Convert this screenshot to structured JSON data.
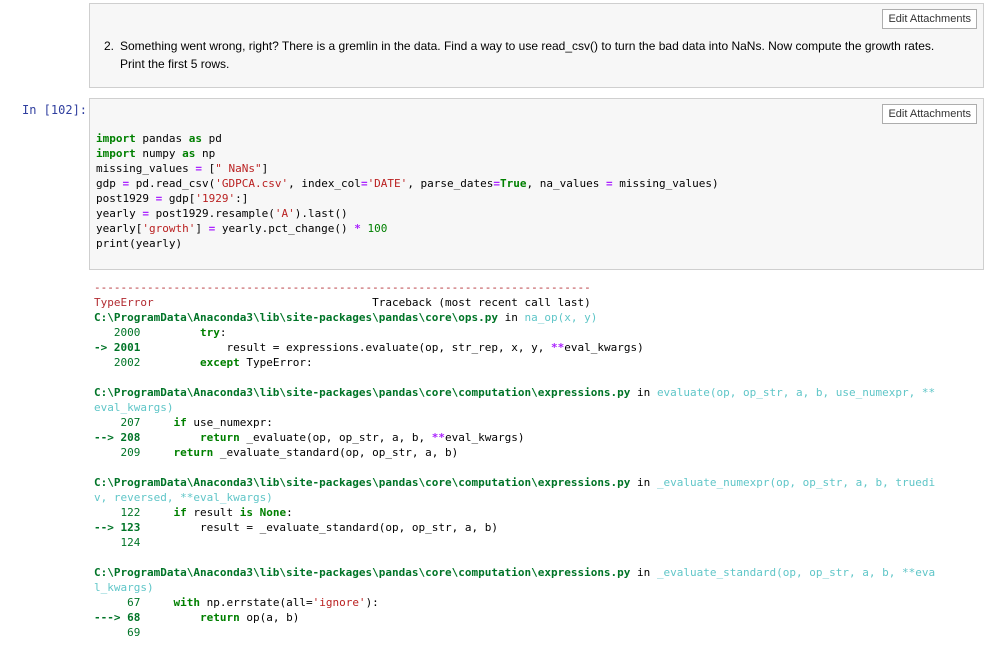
{
  "markdown_cell": {
    "edit_button": "Edit Attachments",
    "item_number": "2.",
    "text_line1": "Something went wrong, right? There is a gremlin in the data. Find a way to use read_csv() to turn the bad data into NaNs. Now compute the growth rates.",
    "text_line2": "Print the first 5 rows."
  },
  "code_cell": {
    "prompt": "In [102]:",
    "edit_button": "Edit Attachments"
  },
  "output": {
    "dashes": "---------------------------------------------------------------------------",
    "error_type": "TypeError",
    "traceback_header": "Traceback (most recent call last)",
    "frames": [
      {
        "path": "C:\\ProgramData\\Anaconda3\\lib\\site-packages\\pandas\\core\\ops.py",
        "func": "na_op(x, y)"
      },
      {
        "path": "C:\\ProgramData\\Anaconda3\\lib\\site-packages\\pandas\\core\\computation\\expressions.py",
        "func": "evaluate(op, op_str, a, b, use_numexpr, **",
        "func_cont": "eval_kwargs)"
      },
      {
        "path": "C:\\ProgramData\\Anaconda3\\lib\\site-packages\\pandas\\core\\computation\\expressions.py",
        "func": "_evaluate_numexpr(op, op_str, a, b, truedi",
        "func_cont": "v, reversed, **eval_kwargs)"
      },
      {
        "path": "C:\\ProgramData\\Anaconda3\\lib\\site-packages\\pandas\\core\\computation\\expressions.py",
        "func": "_evaluate_standard(op, op_str, a, b, **eva",
        "func_cont": "l_kwargs)"
      }
    ]
  }
}
